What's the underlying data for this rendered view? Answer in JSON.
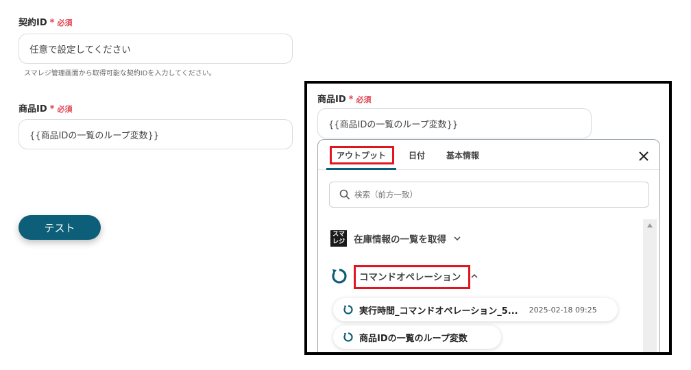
{
  "form": {
    "contract_id": {
      "label": "契約ID",
      "required_mark": "*",
      "required_text": "必須",
      "placeholder": "任意で設定してください",
      "hint": "スマレジ管理画面から取得可能な契約IDを入力してください。"
    },
    "product_id": {
      "label": "商品ID",
      "required_mark": "*",
      "required_text": "必須",
      "value": "{{商品IDの一覧のループ変数}}"
    },
    "test_button": "テスト"
  },
  "callout": {
    "product_id": {
      "label": "商品ID",
      "required_mark": "*",
      "required_text": "必須",
      "value": "{{商品IDの一覧のループ変数}}"
    },
    "panel": {
      "tabs": [
        "アウトプット",
        "日付",
        "基本情報"
      ],
      "active_tab": "アウトプット",
      "search_placeholder": "検索（前方一致）",
      "sections": [
        {
          "logo_text": [
            "スマ",
            "レジ"
          ],
          "label": "在庫情報の一覧を取得",
          "expanded": false
        },
        {
          "label": "コマンドオペレーション",
          "expanded": true
        }
      ],
      "items": [
        {
          "label": "実行時間_コマンドオペレーション_5...",
          "timestamp": "2025-02-18 09:25"
        },
        {
          "label": "商品IDの一覧のループ変数"
        }
      ]
    }
  },
  "colors": {
    "brand": "#0d5e78",
    "required": "#e0414f",
    "highlight": "#e0151f"
  },
  "icons": [
    "search-icon",
    "close-icon",
    "chevron-down-icon",
    "chevron-up-icon",
    "loop-icon",
    "smaregi-logo"
  ]
}
